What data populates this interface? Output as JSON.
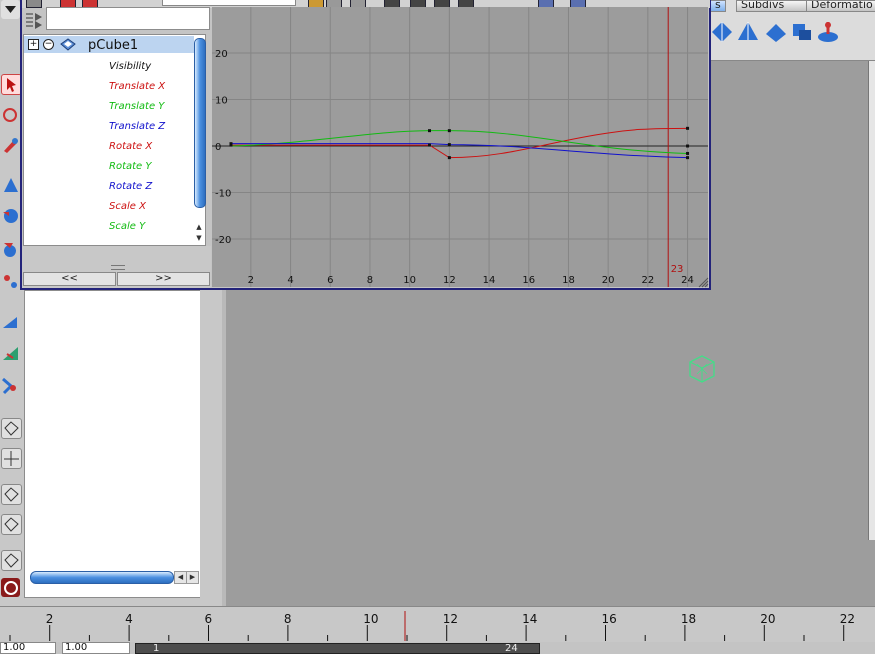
{
  "shelf": {
    "tabs": [
      "s",
      "Subdivs",
      "Deformatio"
    ]
  },
  "graph_editor": {
    "outliner": {
      "node_name": "pCube1",
      "attributes": [
        {
          "label": "Visibility",
          "color": "#111111"
        },
        {
          "label": "Translate X",
          "color": "#cc1111"
        },
        {
          "label": "Translate Y",
          "color": "#11bb11"
        },
        {
          "label": "Translate Z",
          "color": "#1111cc"
        },
        {
          "label": "Rotate X",
          "color": "#cc1111"
        },
        {
          "label": "Rotate Y",
          "color": "#11bb11"
        },
        {
          "label": "Rotate Z",
          "color": "#1111cc"
        },
        {
          "label": "Scale X",
          "color": "#cc1111"
        },
        {
          "label": "Scale Y",
          "color": "#11bb11"
        },
        {
          "label": "Scale Z",
          "color": "#1111cc"
        }
      ],
      "prev_button": "<<",
      "next_button": ">>"
    },
    "graph": {
      "y_ticks": [
        "20",
        "10",
        "0",
        "-10",
        "-20"
      ],
      "x_ticks": [
        "2",
        "4",
        "6",
        "8",
        "10",
        "12",
        "14",
        "16",
        "18",
        "20",
        "22",
        "24"
      ],
      "current_frame": "23",
      "curve_colors": {
        "x": "#cc1111",
        "y": "#11bb11",
        "z": "#1111cc"
      }
    }
  },
  "timeslider": {
    "ticks": [
      "2",
      "4",
      "6",
      "8",
      "10",
      "12",
      "14",
      "16",
      "18",
      "20",
      "22"
    ]
  },
  "range": {
    "start_field": "1.00",
    "start_field2": "1.00",
    "slider_start": "1",
    "slider_end": "24"
  }
}
